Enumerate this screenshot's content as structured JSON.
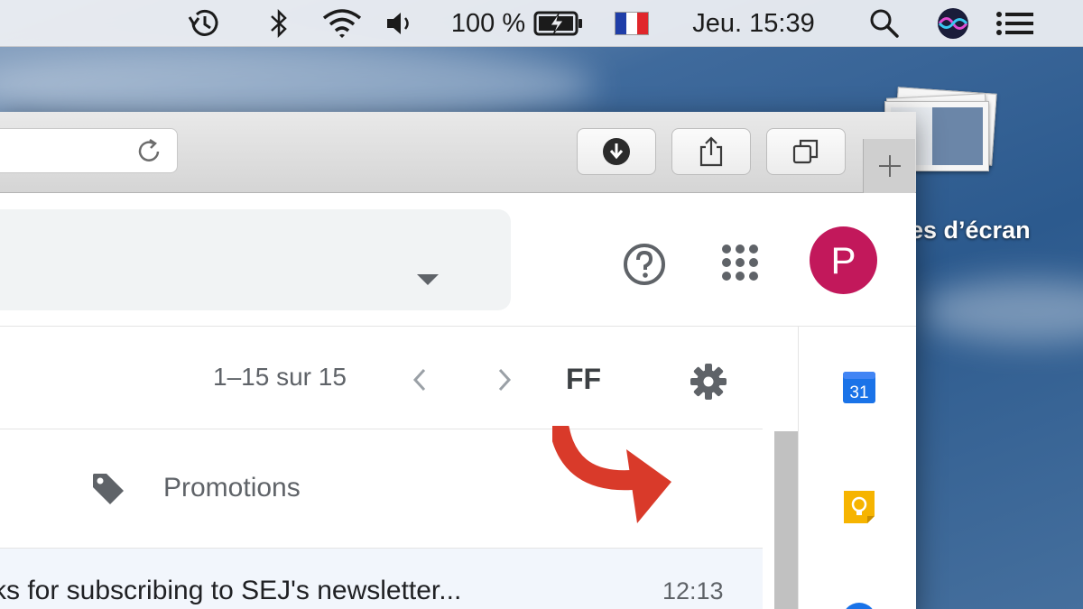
{
  "menubar": {
    "battery_label": "100 %",
    "clock": "Jeu. 15:39",
    "icons": [
      "time-machine-icon",
      "bluetooth-icon",
      "wifi-icon",
      "volume-icon",
      "battery-icon",
      "flag-icon",
      "spotlight-icon",
      "siri-icon",
      "notification-center-icon"
    ]
  },
  "desktop": {
    "screenshots_label": "es d’écran"
  },
  "browser": {
    "toolbar_icons": [
      "reload-icon",
      "downloads-icon",
      "share-icon",
      "tabs-overview-icon",
      "new-tab-icon"
    ]
  },
  "gmail": {
    "avatar_letter": "P",
    "avatar_color": "#c2185b",
    "pager_text": "1–15 sur 15",
    "density_label": "FF",
    "promotions_label": "Promotions",
    "mail": {
      "subject": "ks for subscribing to SEJ's newsletter...",
      "time": "12:13"
    },
    "calendar_day": "31"
  },
  "annotation": {
    "arrow_color": "#d93a2a"
  }
}
